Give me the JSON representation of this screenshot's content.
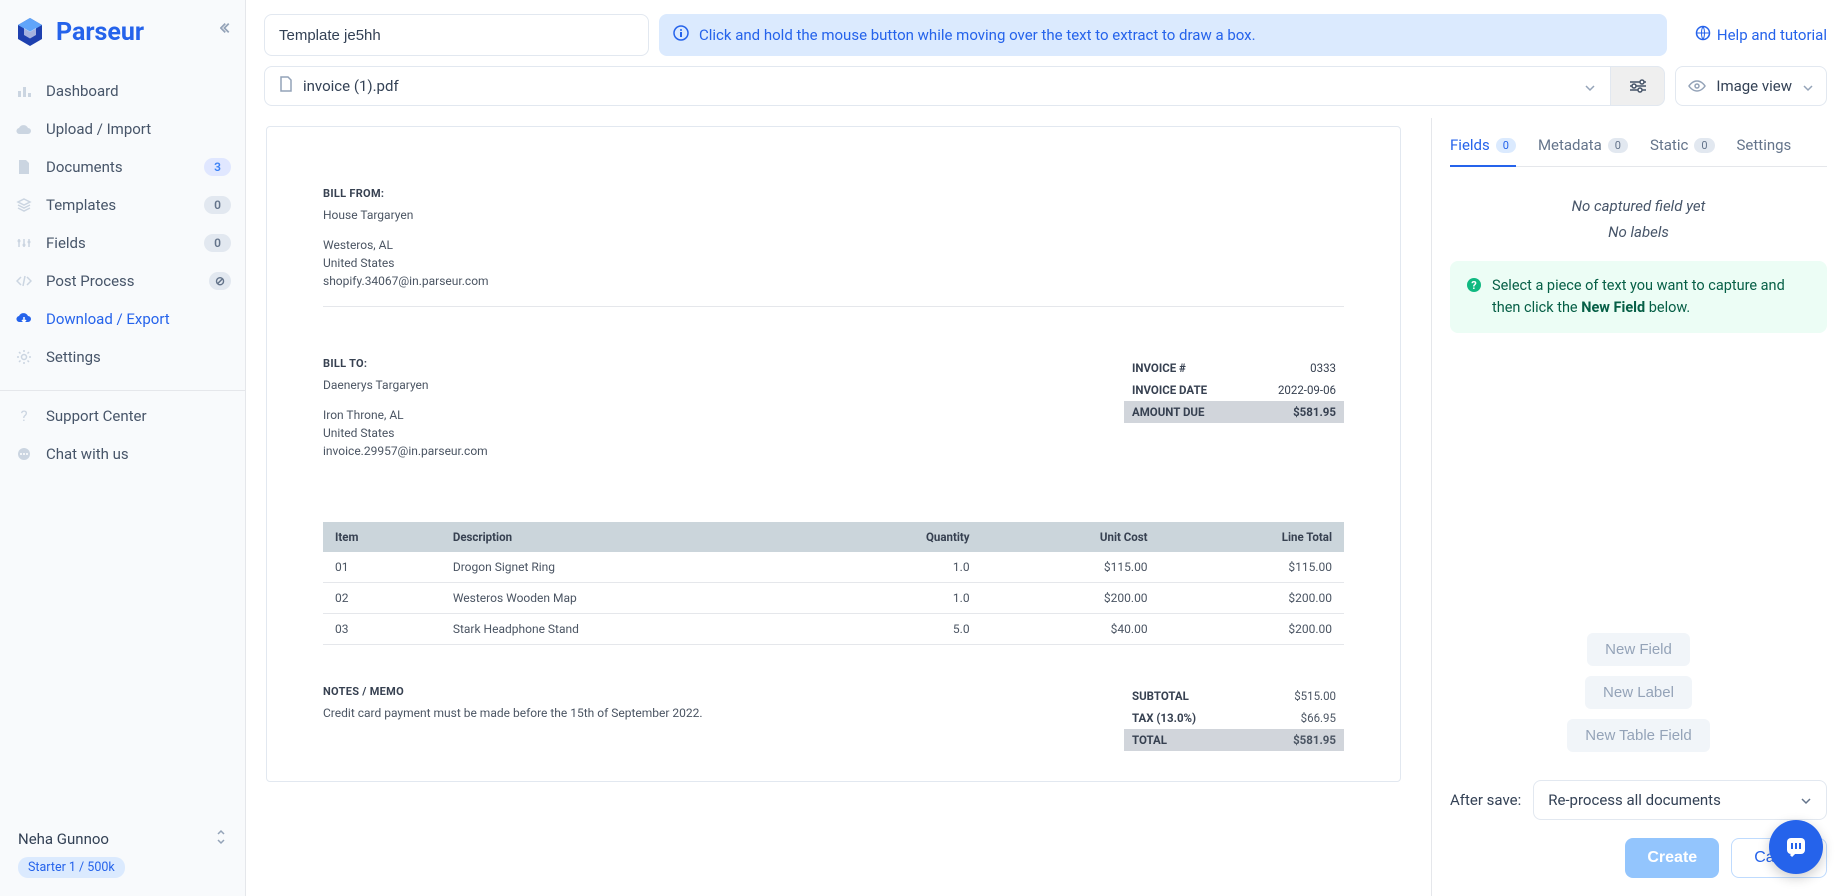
{
  "brand": "Parseur",
  "sidebar": {
    "items": [
      {
        "label": "Dashboard",
        "icon": "chart"
      },
      {
        "label": "Upload / Import",
        "icon": "cloud"
      },
      {
        "label": "Documents",
        "icon": "doc",
        "badge": "3",
        "badgeClass": ""
      },
      {
        "label": "Templates",
        "icon": "layers",
        "badge": "0",
        "badgeClass": "zero"
      },
      {
        "label": "Fields",
        "icon": "sliders",
        "badge": "0",
        "badgeClass": "zero"
      },
      {
        "label": "Post Process",
        "icon": "code",
        "badge": "⊘",
        "badgeClass": "block"
      },
      {
        "label": "Download / Export",
        "icon": "download",
        "active": true
      },
      {
        "label": "Settings",
        "icon": "gear"
      }
    ],
    "support": "Support Center",
    "chat": "Chat with us",
    "user": "Neha Gunnoo",
    "plan": "Starter 1 / 500k"
  },
  "template_name": "Template je5hh",
  "hint": "Click and hold the mouse button while moving over the text to extract to draw a box.",
  "help_link": "Help and tutorial",
  "file_name": "invoice (1).pdf",
  "view_mode": "Image view",
  "tabs": {
    "fields": {
      "label": "Fields",
      "count": "0"
    },
    "metadata": {
      "label": "Metadata",
      "count": "0"
    },
    "static": {
      "label": "Static",
      "count": "0"
    },
    "settings": {
      "label": "Settings"
    }
  },
  "panel": {
    "empty1": "No captured field yet",
    "empty2": "No labels",
    "tip_pre": "Select a piece of text you want to capture and then click the ",
    "tip_bold": "New Field",
    "tip_post": " below.",
    "new_field": "New Field",
    "new_label": "New Label",
    "new_table": "New Table Field",
    "after_save_label": "After save:",
    "after_save_value": "Re-process all documents",
    "create": "Create",
    "cancel": "Cancel"
  },
  "invoice": {
    "bill_from_title": "BILL FROM:",
    "bill_from_name": "House Targaryen",
    "bill_from_addr1": "Westeros, AL",
    "bill_from_addr2": "United States",
    "bill_from_email": "shopify.34067@in.parseur.com",
    "bill_to_title": "BILL TO:",
    "bill_to_name": "Daenerys Targaryen",
    "bill_to_addr1": "Iron Throne, AL",
    "bill_to_addr2": "United States",
    "bill_to_email": "invoice.29957@in.parseur.com",
    "meta": {
      "invoice_no_label": "INVOICE #",
      "invoice_no": "0333",
      "invoice_date_label": "INVOICE DATE",
      "invoice_date": "2022-09-06",
      "amount_due_label": "AMOUNT DUE",
      "amount_due": "$581.95"
    },
    "cols": {
      "item": "Item",
      "desc": "Description",
      "qty": "Quantity",
      "cost": "Unit Cost",
      "total": "Line Total"
    },
    "rows": [
      {
        "item": "01",
        "desc": "Drogon Signet Ring",
        "qty": "1.0",
        "cost": "$115.00",
        "total": "$115.00"
      },
      {
        "item": "02",
        "desc": "Westeros Wooden Map",
        "qty": "1.0",
        "cost": "$200.00",
        "total": "$200.00"
      },
      {
        "item": "03",
        "desc": "Stark Headphone Stand",
        "qty": "5.0",
        "cost": "$40.00",
        "total": "$200.00"
      }
    ],
    "notes_title": "NOTES / MEMO",
    "notes_text": "Credit card payment must be made before the 15th of September 2022.",
    "totals": {
      "subtotal_label": "SUBTOTAL",
      "subtotal": "$515.00",
      "tax_label": "TAX (13.0%)",
      "tax": "$66.95",
      "total_label": "TOTAL",
      "total": "$581.95"
    }
  }
}
